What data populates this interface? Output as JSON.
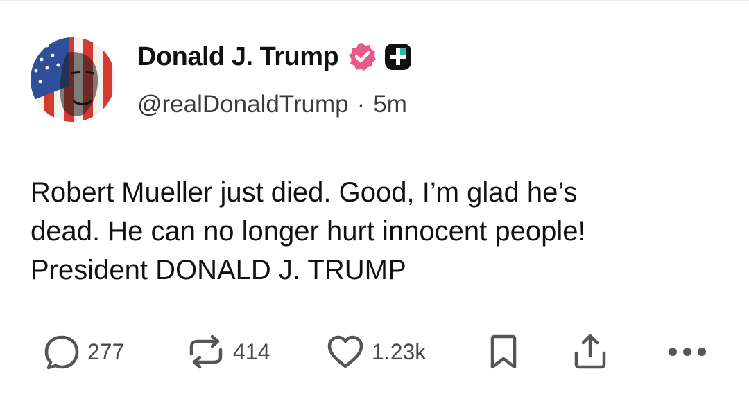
{
  "post": {
    "author": {
      "display_name": "Donald J. Trump",
      "handle": "@realDonaldTrump",
      "separator": "·",
      "time_ago": "5m",
      "verified_badge_color": "#e65a8c",
      "plus_badge_color": "#111111"
    },
    "body_lines": [
      "Robert Mueller just died. Good, I’m glad he’s",
      "dead. He can no longer hurt innocent people!",
      "President DONALD J. TRUMP"
    ],
    "actions": {
      "replies": "277",
      "reposts": "414",
      "likes": "1.23k"
    },
    "icons": {
      "reply": "speech-bubble-icon",
      "repost": "repost-arrows-icon",
      "like": "heart-icon",
      "bookmark": "bookmark-icon",
      "share": "share-upload-icon",
      "more": "more-dots-icon"
    }
  }
}
